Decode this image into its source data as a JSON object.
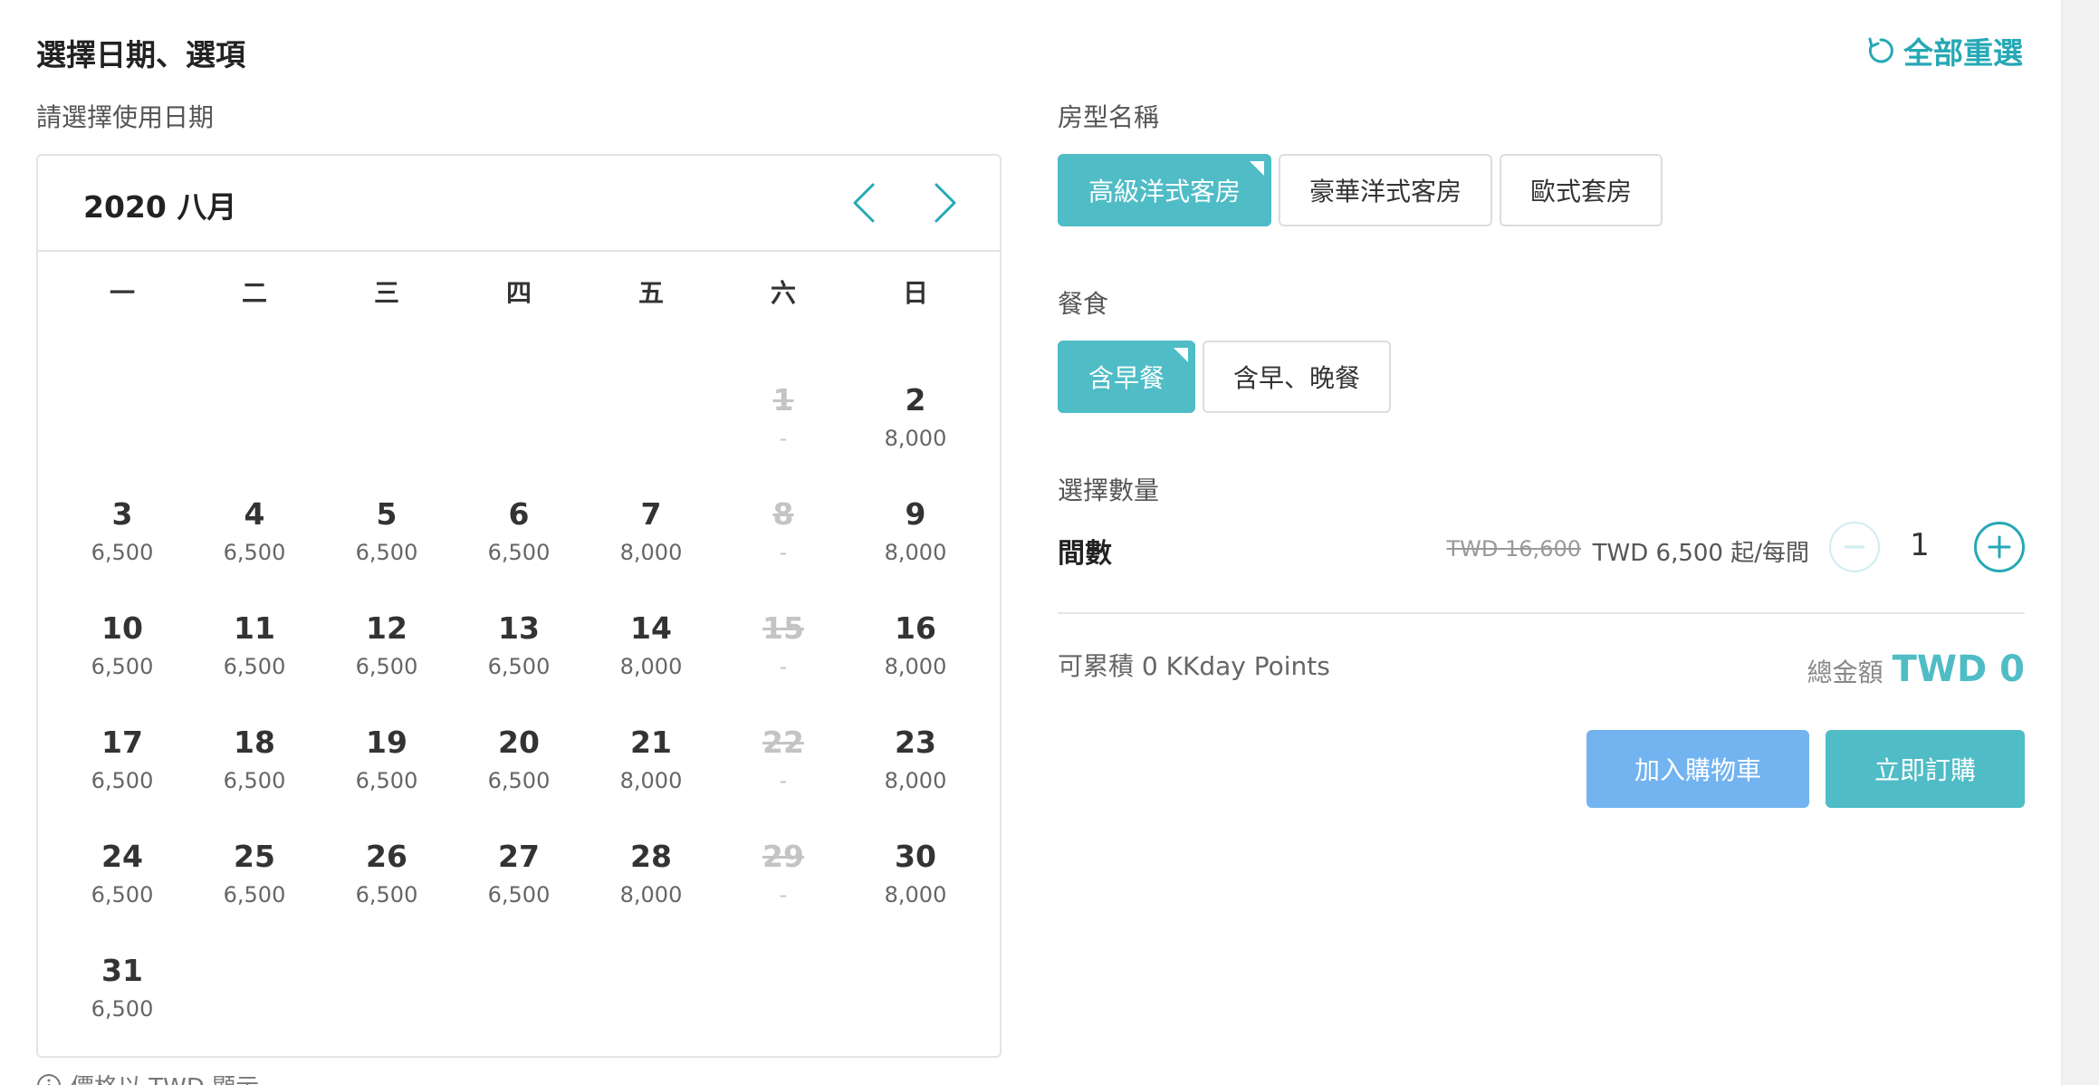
{
  "header": {
    "title": "選擇日期、選項",
    "reset_label": "全部重選"
  },
  "calendar": {
    "label": "請選擇使用日期",
    "month_title": "2020 八月",
    "weekdays": [
      "一",
      "二",
      "三",
      "四",
      "五",
      "六",
      "日"
    ],
    "leading_blanks": 5,
    "days": [
      {
        "day": "1",
        "price": "-",
        "disabled": true
      },
      {
        "day": "2",
        "price": "8,000",
        "disabled": false
      },
      {
        "day": "3",
        "price": "6,500",
        "disabled": false
      },
      {
        "day": "4",
        "price": "6,500",
        "disabled": false
      },
      {
        "day": "5",
        "price": "6,500",
        "disabled": false
      },
      {
        "day": "6",
        "price": "6,500",
        "disabled": false
      },
      {
        "day": "7",
        "price": "8,000",
        "disabled": false
      },
      {
        "day": "8",
        "price": "-",
        "disabled": true
      },
      {
        "day": "9",
        "price": "8,000",
        "disabled": false
      },
      {
        "day": "10",
        "price": "6,500",
        "disabled": false
      },
      {
        "day": "11",
        "price": "6,500",
        "disabled": false
      },
      {
        "day": "12",
        "price": "6,500",
        "disabled": false
      },
      {
        "day": "13",
        "price": "6,500",
        "disabled": false
      },
      {
        "day": "14",
        "price": "8,000",
        "disabled": false
      },
      {
        "day": "15",
        "price": "-",
        "disabled": true
      },
      {
        "day": "16",
        "price": "8,000",
        "disabled": false
      },
      {
        "day": "17",
        "price": "6,500",
        "disabled": false
      },
      {
        "day": "18",
        "price": "6,500",
        "disabled": false
      },
      {
        "day": "19",
        "price": "6,500",
        "disabled": false
      },
      {
        "day": "20",
        "price": "6,500",
        "disabled": false
      },
      {
        "day": "21",
        "price": "8,000",
        "disabled": false
      },
      {
        "day": "22",
        "price": "-",
        "disabled": true
      },
      {
        "day": "23",
        "price": "8,000",
        "disabled": false
      },
      {
        "day": "24",
        "price": "6,500",
        "disabled": false
      },
      {
        "day": "25",
        "price": "6,500",
        "disabled": false
      },
      {
        "day": "26",
        "price": "6,500",
        "disabled": false
      },
      {
        "day": "27",
        "price": "6,500",
        "disabled": false
      },
      {
        "day": "28",
        "price": "8,000",
        "disabled": false
      },
      {
        "day": "29",
        "price": "-",
        "disabled": true
      },
      {
        "day": "30",
        "price": "8,000",
        "disabled": false
      },
      {
        "day": "31",
        "price": "6,500",
        "disabled": false
      }
    ],
    "footnote": "價格以 TWD 顯示"
  },
  "room_type": {
    "label": "房型名稱",
    "options": [
      {
        "label": "高級洋式客房",
        "selected": true
      },
      {
        "label": "豪華洋式客房",
        "selected": false
      },
      {
        "label": "歐式套房",
        "selected": false
      }
    ]
  },
  "meal": {
    "label": "餐食",
    "options": [
      {
        "label": "含早餐",
        "selected": true
      },
      {
        "label": "含早、晚餐",
        "selected": false
      }
    ]
  },
  "quantity": {
    "label": "選擇數量",
    "unit_name": "間數",
    "original_price": "TWD 16,600",
    "price": "TWD 6,500 起/每間",
    "value": "1"
  },
  "summary": {
    "points": "可累積 0 KKday Points",
    "total_label": "總金額",
    "total_value": "TWD 0"
  },
  "actions": {
    "add_to_cart": "加入購物車",
    "book_now": "立即訂購"
  },
  "colors": {
    "accent": "#4fbcc6",
    "accent_dark": "#26a8b5",
    "cart_blue": "#72b3f0"
  }
}
